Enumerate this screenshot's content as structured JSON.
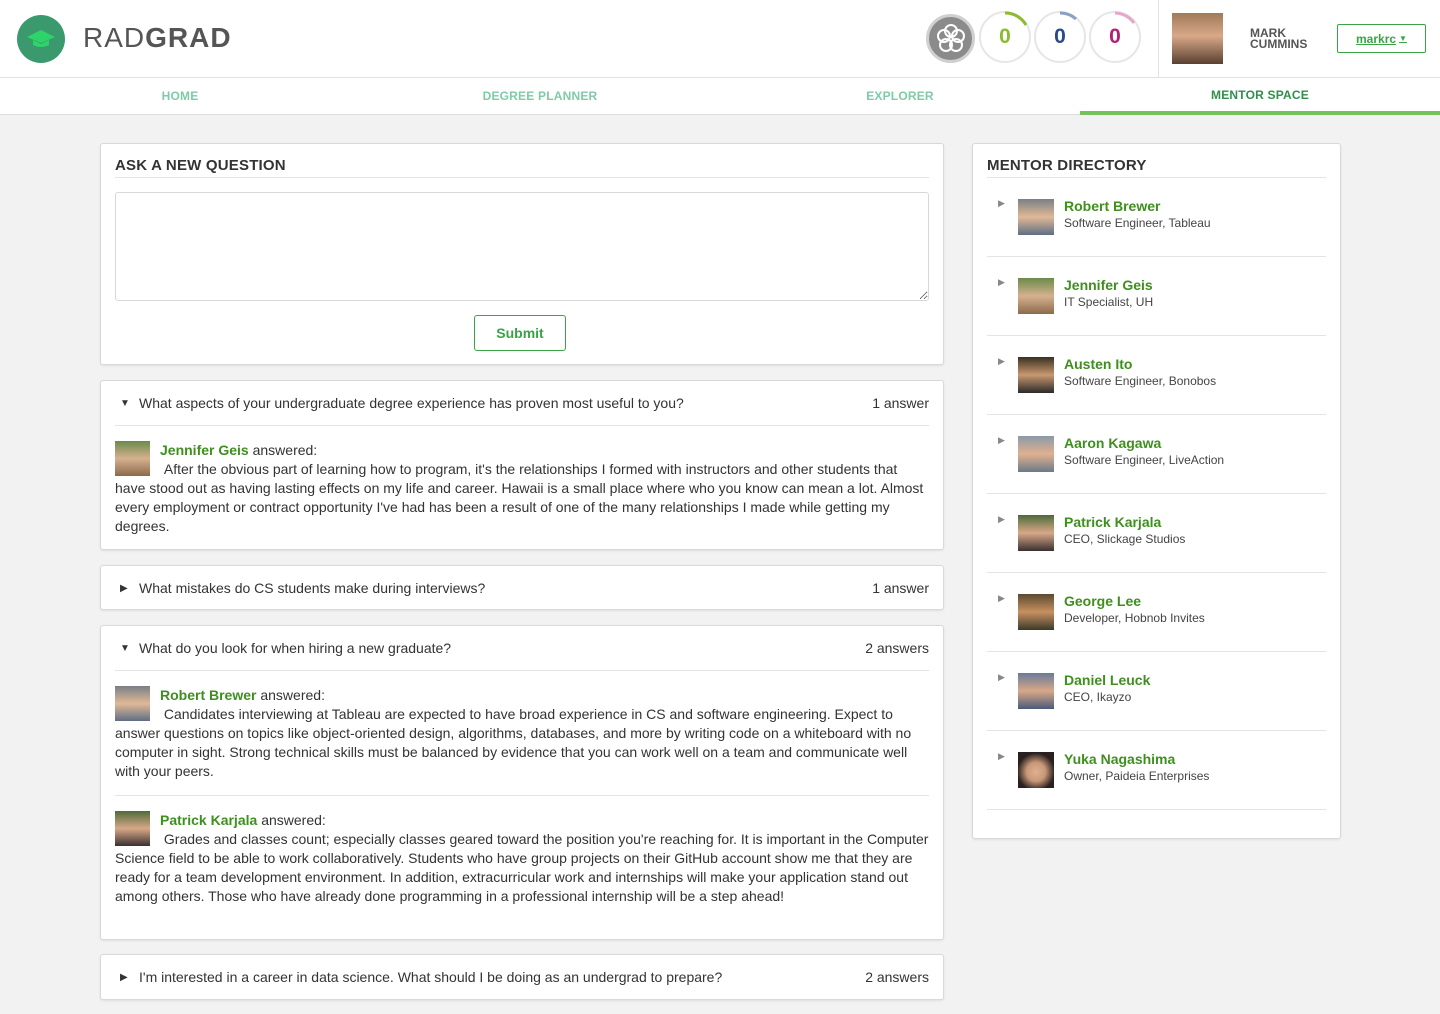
{
  "brand": {
    "name_light": "RAD",
    "name_bold": "GRAD"
  },
  "scores": [
    {
      "value": "0",
      "color": "#8dbb2e"
    },
    {
      "value": "0",
      "color": "#2a4b86"
    },
    {
      "value": "0",
      "color": "#b0217a"
    }
  ],
  "user": {
    "name": "MARK CUMMINS",
    "username": "markrc"
  },
  "nav": {
    "tabs": [
      "HOME",
      "DEGREE PLANNER",
      "EXPLORER",
      "MENTOR SPACE"
    ],
    "active": "MENTOR SPACE"
  },
  "ask": {
    "title": "ASK A NEW QUESTION",
    "submit_label": "Submit",
    "placeholder": ""
  },
  "questions": [
    {
      "text": "What aspects of your undergraduate degree experience has proven most useful to you?",
      "count": "1 answer",
      "answers": [
        {
          "author": "Jennifer Geis",
          "suffix": "answered:",
          "text": "After the obvious part of learning how to program, it's the relationships I formed with instructors and other students that have stood out as having lasting effects on my life and career. Hawaii is a small place where who you know can mean a lot. Almost every employment or contract opportunity I've had has been a result of one of the many relationships I made while getting my degrees."
        }
      ]
    },
    {
      "text": "What mistakes do CS students make during interviews?",
      "count": "1 answer",
      "answers": []
    },
    {
      "text": "What do you look for when hiring a new graduate?",
      "count": "2 answers",
      "answers": [
        {
          "author": "Robert Brewer",
          "suffix": "answered:",
          "text": "Candidates interviewing at Tableau are expected to have broad experience in CS and software engineering. Expect to answer questions on topics like object-oriented design, algorithms, databases, and more by writing code on a whiteboard with no computer in sight. Strong technical skills must be balanced by evidence that you can work well on a team and communicate well with your peers."
        },
        {
          "author": "Patrick Karjala",
          "suffix": "answered:",
          "text": "Grades and classes count; especially classes geared toward the position you're reaching for. It is important in the Computer Science field to be able to work collaboratively. Students who have group projects on their GitHub account show me that they are ready for a team development environment. In addition, extracurricular work and internships will make your application stand out among others. Those who have already done programming in a professional internship will be a step ahead!"
        }
      ]
    },
    {
      "text": "I'm interested in a career in data science. What should I be doing as an undergrad to prepare?",
      "count": "2 answers",
      "answers": []
    }
  ],
  "directory": {
    "title": "MENTOR DIRECTORY",
    "mentors": [
      {
        "name": "Robert Brewer",
        "title": "Software Engineer, Tableau"
      },
      {
        "name": "Jennifer Geis",
        "title": "IT Specialist, UH"
      },
      {
        "name": "Austen Ito",
        "title": "Software Engineer, Bonobos"
      },
      {
        "name": "Aaron Kagawa",
        "title": "Software Engineer, LiveAction"
      },
      {
        "name": "Patrick Karjala",
        "title": "CEO, Slickage Studios"
      },
      {
        "name": "George Lee",
        "title": "Developer, Hobnob Invites"
      },
      {
        "name": "Daniel Leuck",
        "title": "CEO, Ikayzo"
      },
      {
        "name": "Yuka Nagashima",
        "title": "Owner, Paideia Enterprises"
      }
    ]
  },
  "colors": {
    "accent": "#3f8f1f",
    "nav": "#7ecba7",
    "nav_active": "#2f8f4b",
    "brand": "#3a9a6d"
  }
}
